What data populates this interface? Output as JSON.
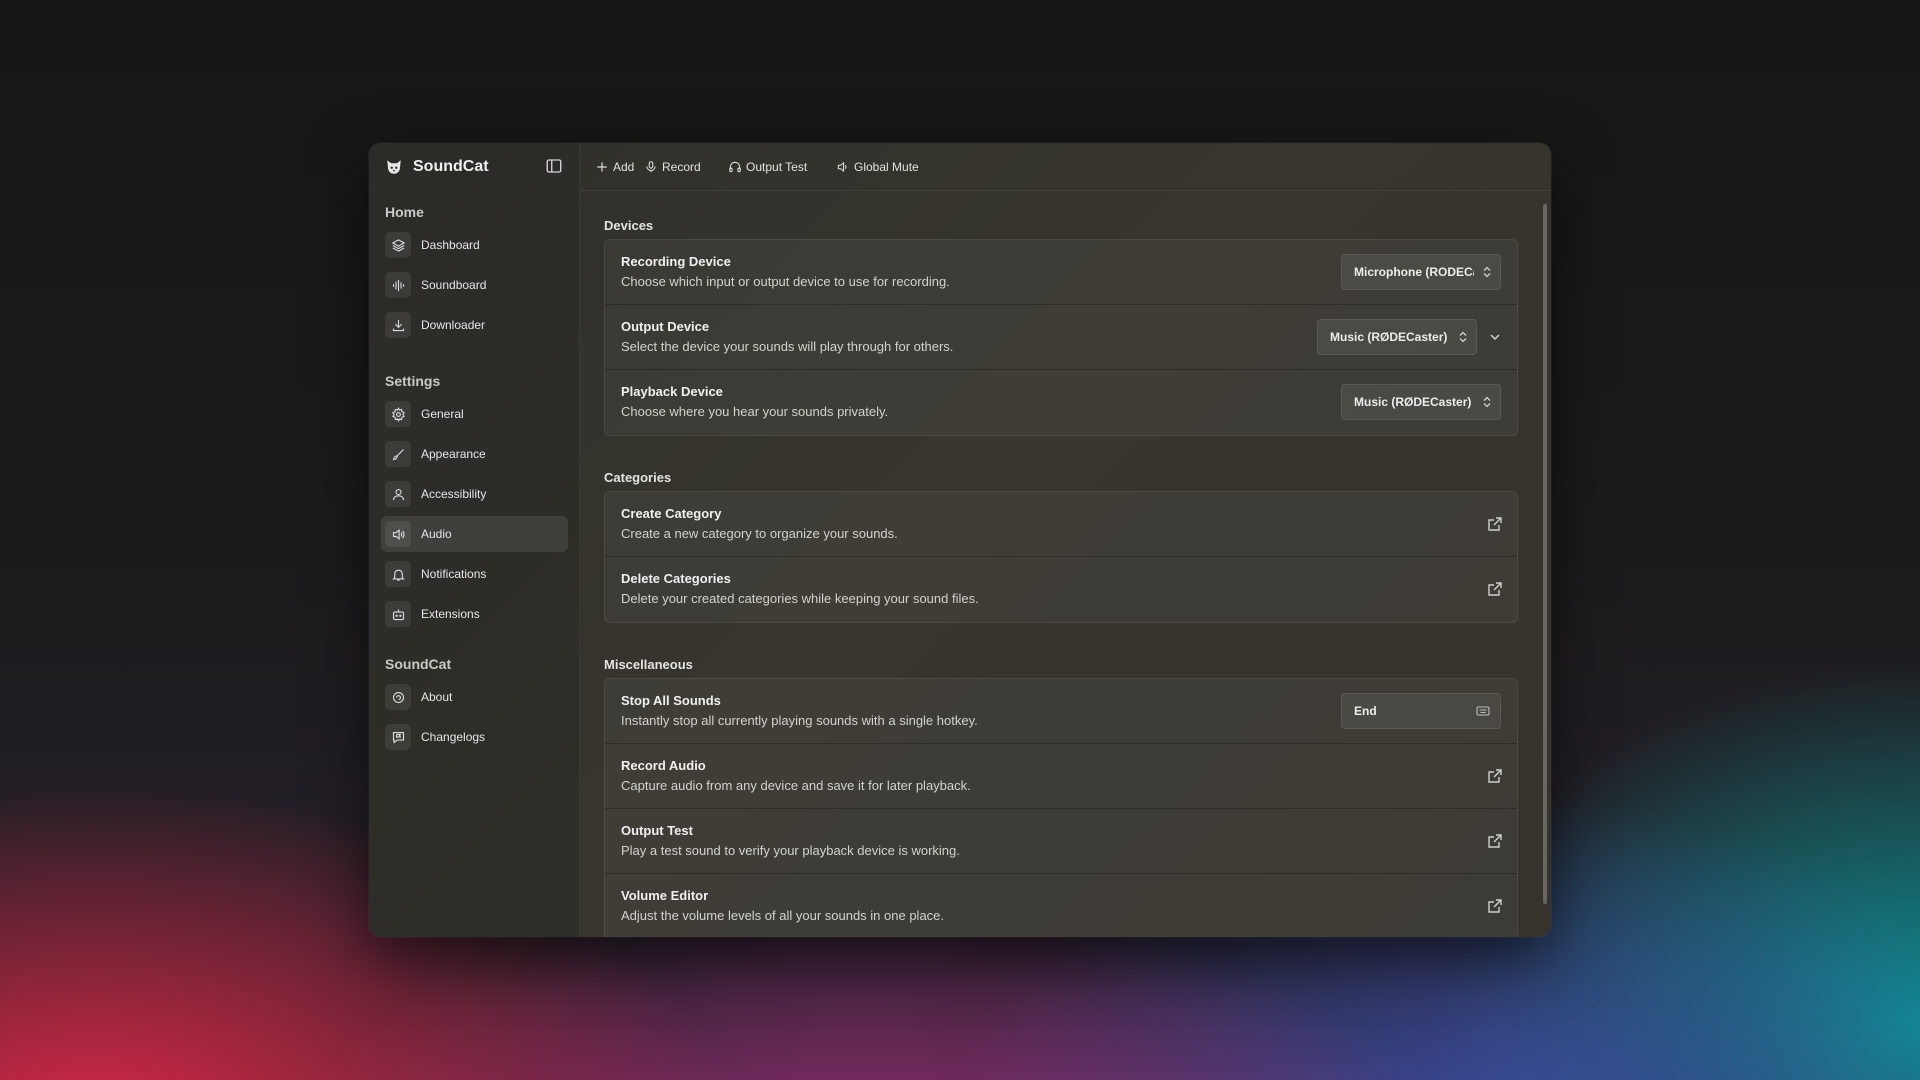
{
  "app": {
    "name": "SoundCat"
  },
  "toolbar": {
    "add_label": "Add",
    "record_label": "Record",
    "output_test_label": "Output Test",
    "global_mute_label": "Global Mute"
  },
  "sidebar": {
    "sections": [
      {
        "heading": "Home",
        "items": [
          {
            "label": "Dashboard",
            "icon": "layers-icon"
          },
          {
            "label": "Soundboard",
            "icon": "waveform-icon"
          },
          {
            "label": "Downloader",
            "icon": "download-icon"
          }
        ]
      },
      {
        "heading": "Settings",
        "items": [
          {
            "label": "General",
            "icon": "gear-icon"
          },
          {
            "label": "Appearance",
            "icon": "brush-icon"
          },
          {
            "label": "Accessibility",
            "icon": "person-icon"
          },
          {
            "label": "Audio",
            "icon": "speaker-icon",
            "active": true
          },
          {
            "label": "Notifications",
            "icon": "bell-icon"
          },
          {
            "label": "Extensions",
            "icon": "robot-icon"
          }
        ]
      },
      {
        "heading": "SoundCat",
        "items": [
          {
            "label": "About",
            "icon": "info-chat-icon"
          },
          {
            "label": "Changelogs",
            "icon": "flag-chat-icon"
          }
        ]
      }
    ]
  },
  "devices": {
    "title": "Devices",
    "recording": {
      "title": "Recording Device",
      "desc": "Choose which input or output device to use for recording.",
      "value": "Microphone (RODECaster Pro)"
    },
    "output": {
      "title": "Output Device",
      "desc": "Select the device your sounds will play through for others.",
      "value": "Music (RØDECaster)"
    },
    "playback": {
      "title": "Playback Device",
      "desc": "Choose where you hear your sounds privately.",
      "value": "Music (RØDECaster)"
    }
  },
  "categories": {
    "title": "Categories",
    "create": {
      "title": "Create Category",
      "desc": "Create a new category to organize your sounds."
    },
    "delete": {
      "title": "Delete Categories",
      "desc": "Delete your created categories while keeping your sound files."
    }
  },
  "misc": {
    "title": "Miscellaneous",
    "stop_all": {
      "title": "Stop All Sounds",
      "desc": "Instantly stop all currently playing sounds with a single hotkey.",
      "hotkey": "End"
    },
    "record_audio": {
      "title": "Record Audio",
      "desc": "Capture audio from any device and save it for later playback."
    },
    "output_test": {
      "title": "Output Test",
      "desc": "Play a test sound to verify your playback device is working."
    },
    "volume_editor": {
      "title": "Volume Editor",
      "desc": "Adjust the volume levels of all your sounds in one place."
    }
  },
  "colors": {
    "window_bg": "#35332c",
    "sidebar_bg": "#2e2e2b",
    "accent_avatar": "#3f7fd8"
  }
}
